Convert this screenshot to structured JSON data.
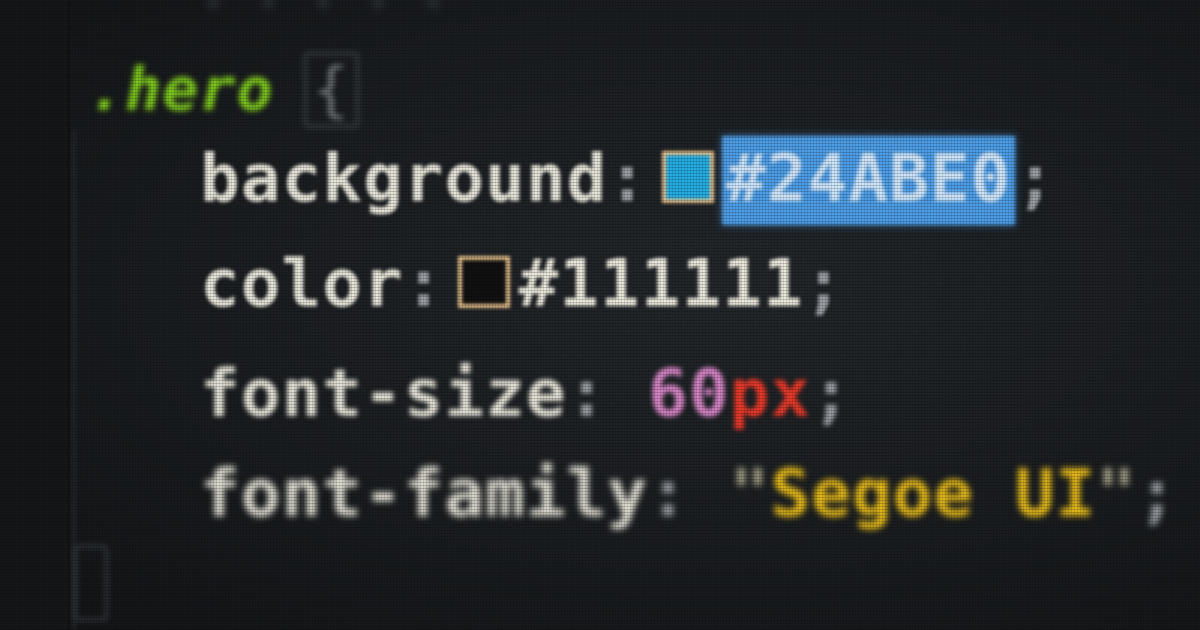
{
  "editor": {
    "top_faded_line": "· · · · ·",
    "selector": ".hero",
    "open_brace": "{",
    "declarations": [
      {
        "property": "background",
        "colon": ":",
        "swatch_color": "#24ABE0",
        "value": "#24ABE0",
        "selected": true,
        "semicolon": ";"
      },
      {
        "property": "color",
        "colon": ":",
        "swatch_color": "#111111",
        "value": "#111111",
        "semicolon": ";"
      },
      {
        "property": "font-size",
        "colon": ":",
        "value_number": "60",
        "value_unit": "px",
        "semicolon": ";"
      },
      {
        "property": "font-family",
        "colon": ":",
        "quote_open": "\"",
        "value_string": "Segoe UI",
        "quote_close": "\"",
        "semicolon": ";"
      }
    ]
  },
  "colors": {
    "selector": "#86D61F",
    "property": "#E8E6DA",
    "selection": "#4D9DE6",
    "number": "#D987C8",
    "unit": "#EE3A2A",
    "string": "#F0C21A",
    "background": "#1A1D20"
  }
}
